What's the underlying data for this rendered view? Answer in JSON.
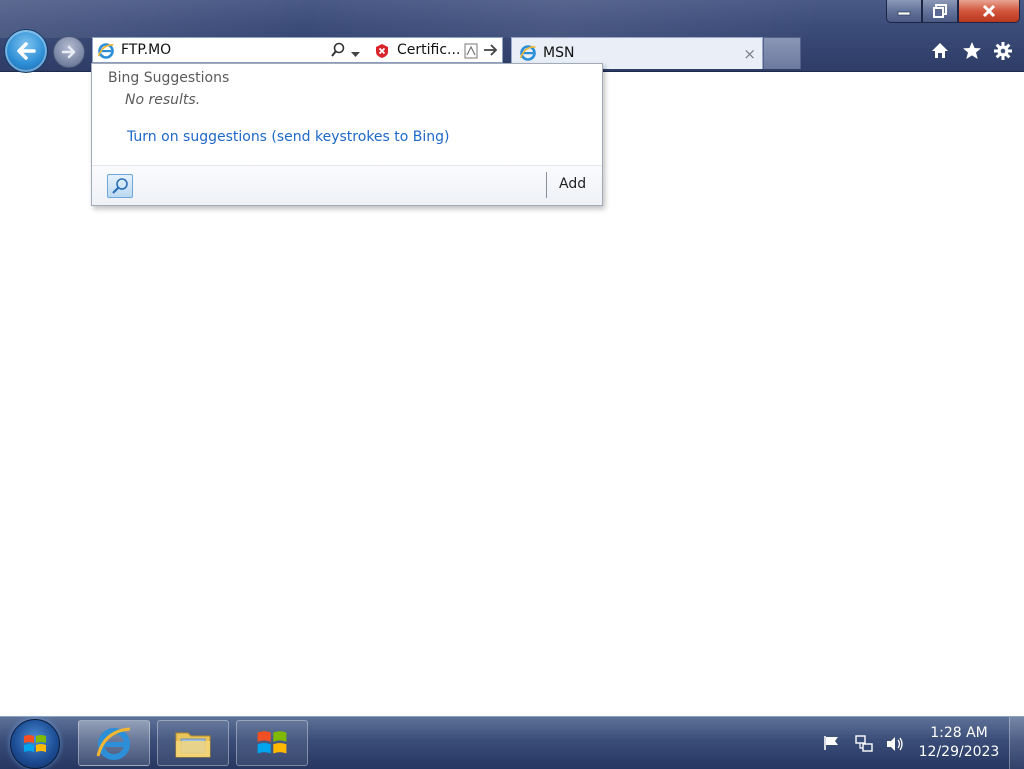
{
  "browser": {
    "address": {
      "value": "FTP.MO",
      "certificate_label": "Certific..."
    },
    "tab": {
      "title": "MSN",
      "close_glyph": "×"
    },
    "icons": {
      "back": "back-arrow-icon",
      "forward": "forward-arrow-icon",
      "home": "home-icon",
      "favorites": "star-icon",
      "tools": "gear-icon"
    }
  },
  "suggestions": {
    "heading": "Bing Suggestions",
    "no_results": "No results.",
    "enable_link": "Turn on suggestions (send keystrokes to Bing)",
    "add_label": "Add"
  },
  "taskbar": {
    "time": "1:28 AM",
    "date": "12/29/2023",
    "pinned": [
      "internet-explorer",
      "windows-explorer",
      "windows-media"
    ]
  },
  "colors": {
    "accent_link": "#1e68c8",
    "chrome": "#3d4d7a",
    "close_button": "#d2553c"
  }
}
